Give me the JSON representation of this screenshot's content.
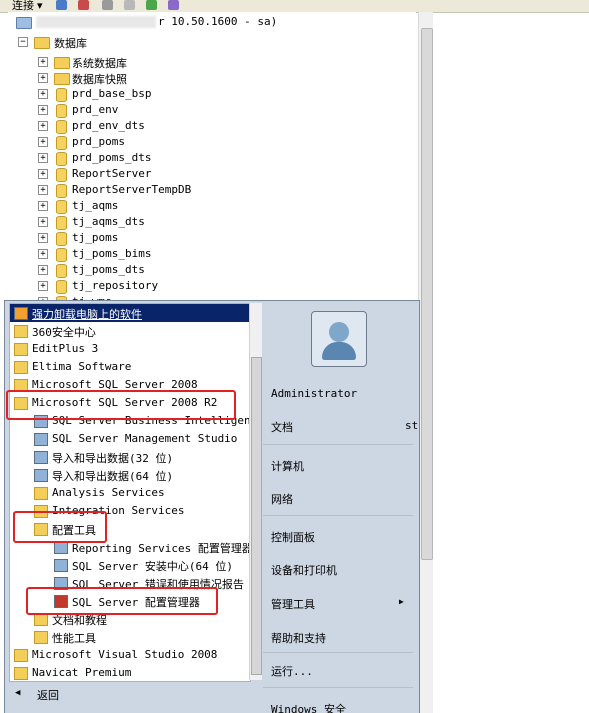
{
  "toolbar": {
    "connect_label": "连接 ▾"
  },
  "tree": {
    "server_suffix": "r 10.50.1600 - sa)",
    "databases_label": "数据库",
    "items": [
      {
        "label": "系统数据库",
        "icon": "folder"
      },
      {
        "label": "数据库快照",
        "icon": "folder"
      },
      {
        "label": "prd_base_bsp",
        "icon": "database"
      },
      {
        "label": "prd_env",
        "icon": "database"
      },
      {
        "label": "prd_env_dts",
        "icon": "database"
      },
      {
        "label": "prd_poms",
        "icon": "database"
      },
      {
        "label": "prd_poms_dts",
        "icon": "database"
      },
      {
        "label": "ReportServer",
        "icon": "database"
      },
      {
        "label": "ReportServerTempDB",
        "icon": "database"
      },
      {
        "label": "tj_aqms",
        "icon": "database"
      },
      {
        "label": "tj_aqms_dts",
        "icon": "database"
      },
      {
        "label": "tj_poms",
        "icon": "database"
      },
      {
        "label": "tj_poms_bims",
        "icon": "database"
      },
      {
        "label": "tj_poms_dts",
        "icon": "database"
      },
      {
        "label": "tj_repository",
        "icon": "database"
      },
      {
        "label": "tj_wms",
        "icon": "database"
      }
    ]
  },
  "startmenu": {
    "programs": [
      {
        "label": "强力卸载电脑上的软件",
        "level": 0,
        "icon": "uninstall-icon",
        "highlight": true
      },
      {
        "label": "360安全中心",
        "level": 0,
        "icon": "folder-icon"
      },
      {
        "label": "EditPlus 3",
        "level": 0,
        "icon": "folder-icon"
      },
      {
        "label": "Eltima Software",
        "level": 0,
        "icon": "folder-icon"
      },
      {
        "label": "Microsoft SQL Server 2008",
        "level": 0,
        "icon": "folder-icon"
      },
      {
        "label": "Microsoft SQL Server 2008 R2",
        "level": 0,
        "icon": "folder-icon"
      },
      {
        "label": "SQL Server Business Intelligence",
        "level": 1,
        "icon": "bids-icon"
      },
      {
        "label": "SQL Server Management Studio",
        "level": 1,
        "icon": "ssms-icon"
      },
      {
        "label": "导入和导出数据(32 位)",
        "level": 1,
        "icon": "import-export-icon"
      },
      {
        "label": "导入和导出数据(64 位)",
        "level": 1,
        "icon": "import-export-icon"
      },
      {
        "label": "Analysis Services",
        "level": 1,
        "icon": "folder-icon"
      },
      {
        "label": "Integration Services",
        "level": 1,
        "icon": "folder-icon"
      },
      {
        "label": "配置工具",
        "level": 1,
        "icon": "folder-icon"
      },
      {
        "label": "Reporting Services 配置管理器",
        "level": 2,
        "icon": "reporting-config-icon"
      },
      {
        "label": "SQL Server 安装中心(64 位)",
        "level": 2,
        "icon": "install-center-icon"
      },
      {
        "label": "SQL Server 错误和使用情况报告",
        "level": 2,
        "icon": "error-report-icon"
      },
      {
        "label": "SQL Server 配置管理器",
        "level": 2,
        "icon": "config-manager-icon"
      },
      {
        "label": "文档和教程",
        "level": 1,
        "icon": "folder-icon"
      },
      {
        "label": "性能工具",
        "level": 1,
        "icon": "folder-icon"
      },
      {
        "label": "Microsoft Visual Studio 2008",
        "level": 0,
        "icon": "folder-icon"
      },
      {
        "label": "Navicat Premium",
        "level": 0,
        "icon": "folder-icon"
      }
    ],
    "back_label": "返回",
    "right_items": [
      {
        "label": "Administrator",
        "arrow": false,
        "sep_after": false
      },
      {
        "label": "文档",
        "arrow": false,
        "sep_after": true
      },
      {
        "label": "计算机",
        "arrow": false,
        "sep_after": false
      },
      {
        "label": "网络",
        "arrow": false,
        "sep_after": true
      },
      {
        "label": "控制面板",
        "arrow": false,
        "sep_after": false
      },
      {
        "label": "设备和打印机",
        "arrow": false,
        "sep_after": false
      },
      {
        "label": "管理工具",
        "arrow": true,
        "sep_after": false
      },
      {
        "label": "帮助和支持",
        "arrow": false,
        "sep_after": true
      },
      {
        "label": "运行...",
        "arrow": false,
        "sep_after": true
      },
      {
        "label": "Windows 安全",
        "arrow": false,
        "sep_after": false
      }
    ],
    "stray_text": "st"
  },
  "colors": {
    "highlight_bg": "#0a246a",
    "annotation_red": "#e02222",
    "folder": "#f3cf5a"
  }
}
